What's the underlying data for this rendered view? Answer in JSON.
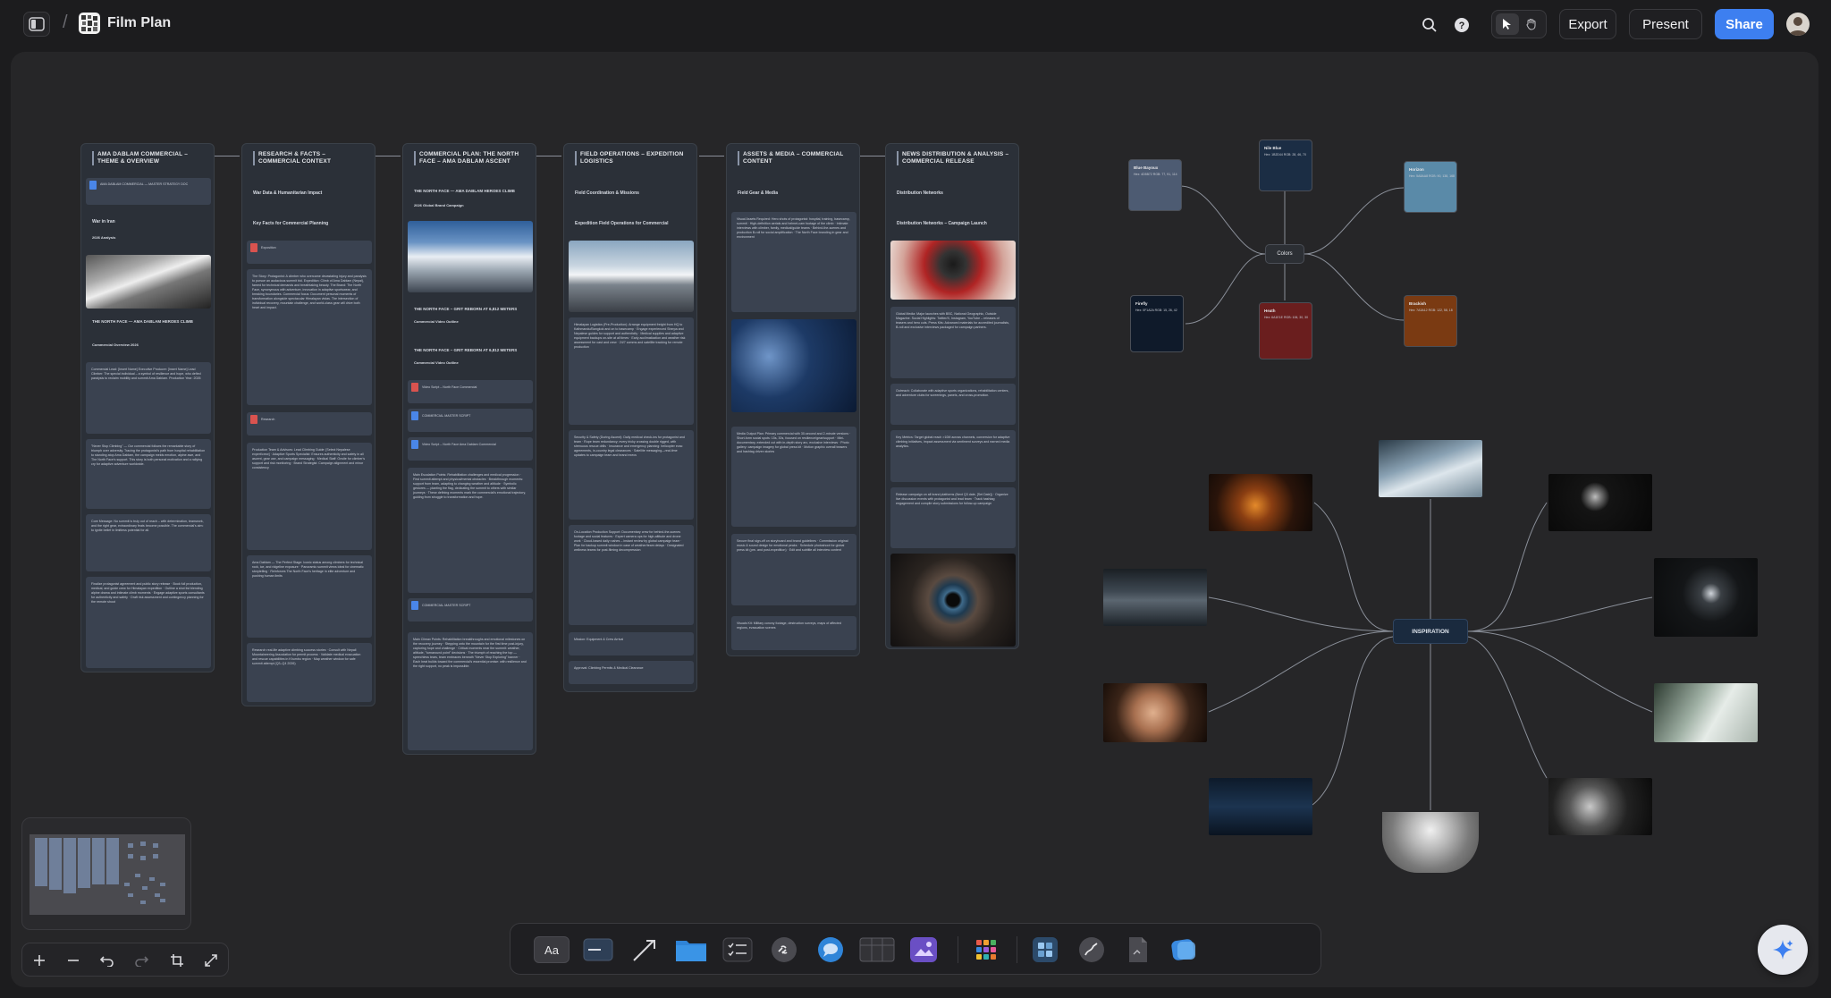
{
  "header": {
    "board_title": "Film Plan",
    "breadcrumb_sep": "/",
    "export_label": "Export",
    "present_label": "Present",
    "share_label": "Share",
    "icons": [
      "sidebar-icon",
      "search-icon",
      "help-icon",
      "pointer-icon",
      "hand-icon",
      "avatar"
    ]
  },
  "columns": [
    {
      "title": "AMA DABLAM COMMERCIAL – THEME & OVERVIEW",
      "lines": [
        "War in Iran",
        "2026 Analysis",
        "THE NORTH FACE — AMA DABLAM HEROES CLIMB",
        "Commercial Overview 2026"
      ],
      "doc": "AMA DABLAM COMMERCIAL — MASTER STRATEGY DOC",
      "card1": "Commercial Lead: [Insert Name] Executive Producer: [Insert Name] Lead Climber: The special individual – a symbol of resilience and hope, who defied paralysis to reclaim mobility and summit Ama Dablam. Production Year: 2026",
      "card2": "\"Never Stop Climbing\" — Our commercial follows the remarkable story of triumph over adversity. Tracing the protagonist's path from hospital rehabilitation to standing atop Ama Dablam, the campaign melds emotion, alpine awe, and The North Face's support. This story is both personal motivation and a rallying cry for adaptive adventure worldwide.",
      "card3": "Core Message: No summit is truly out of reach – with determination, teamwork, and the right gear, extraordinary feats become possible. The commercial's aim: to ignite belief in limitless potential for all.",
      "card4": "Finalize protagonist agreement and public story release · Book full production, medical, and guide crew for Himalayan expedition · Outline a shot list blending alpine drama and intimate climb moments · Engage adaptive sports consultants for authenticity and safety · Draft risk assessment and contingency planning for the remote shoot"
    },
    {
      "title": "RESEARCH & FACTS – COMMERCIAL CONTEXT",
      "lines": [
        "War Data & Humanitarian Impact",
        "Key Facts for Commercial Planning"
      ],
      "doc": "Exposition",
      "card1": "The Story: Protagonist: A climber who overcame devastating injury and paralysis to pursue an audacious summit bid. Expedition: Climb of Ama Dablam (Nepal), famed for technical demands and breathtaking beauty. The Brand: The North Face, synonymous with adventure, innovation in adaptive sportswear, and breaking boundaries. Commercial focus: Document personal moments of transformation alongside spectacular Himalayan vistas. The intersection of individual recovery, mountain challenge, and world-class gear will drive both heart and impact.",
      "doc2": "Research",
      "card2": "Production Team & Advisors: Lead Climbing Guide: [Select Nepalese expert/crew] · Adaptive Sports Specialist: Ensures authenticity and safety in all ascent, gear use, and campaign messaging · Medical Staff: Onsite for climber's support and risk monitoring · Brand Strategist: Campaign alignment and minor consistency",
      "card3": "Ama Dablam — The Perfect Stage: Iconic status among climbers for technical rock, ice, and ridgeline exposure · Panoramic summit views ideal for cinematic storytelling · Reinforces The North Face's heritage in elite adventure and pushing human limits",
      "card4": "Research real-life adaptive climbing success stories · Consult with Nepali Mountaineering Association for permit process · Validate medical evacuation and rescue capabilities in Khumbu region · Map weather window for safe summit attempt (Q3–Q4 2026)"
    },
    {
      "title": "COMMERCIAL PLAN: THE NORTH FACE – AMA DABLAM ASCENT",
      "lines": [
        "THE NORTH FACE — AMA DABLAM HEROES CLIMB",
        "2026 Global Brand Campaign",
        "THE NORTH FACE – GRIT REBORN AT 6,812 METERS",
        "Commercial Video Outline",
        "THE NORTH FACE – GRIT REBORN AT 6,812 METERS",
        "Commercial Video Outline"
      ],
      "docs": [
        "Video Script – North Face Commercial",
        "COMMERCIAL MASTER SCRIPT",
        "Video Script – North Face Ama Dablam Commercial"
      ],
      "card1": "Main Escalation Points: Rehabilitation challenges and medical progression · First summit attempt and physical/mental obstacles · Breakthrough moments: support from team, adapting to changing weather and altitude · Symbolic gestures — planting the flag, dedicating the summit to others with similar journeys · These defining moments mark the commercial's emotional trajectory, guiding from struggle to transformation and hope.",
      "doc4": "COMMERCIAL MASTER SCRIPT",
      "card2": "Main Climax Points: Rehabilitation breakthroughs and emotional milestones on the recovery journey · Stepping onto the mountain for the first time post-injury, capturing hope and challenge · Critical moments near the summit: weather, altitude, \"turnaround point\" decisions · The triumph of reaching the top — speechless tears, team embraces beneath \"Never Stop Exploring\" banner · Each beat builds toward the commercial's essential promise: with resilience and the right support, no peak is impossible."
    },
    {
      "title": "FIELD OPERATIONS – EXPEDITION LOGISTICS",
      "lines": [
        "Field Coordination & Missions",
        "Expedition Field Operations for Commercial"
      ],
      "card1": "Himalayan Logistics (Pre-Production): Arrange equipment freight from HQ to Kathmandu/Bangkok and on to basecamp · Engage experienced Sherpa and Nepalese guides for support and authenticity · Medical supplies and adaptive equipment backups on-site at all times · Early acclimatization and weather risk assessment for cast and crew · 24/7 comms and satellite tracking for remote production",
      "card2": "Security & Safety (During Ascent): Daily medical check-ins for protagonist and team · Rope team redundancy; every tricky crossing double rigged, with strenuous rescue drills · Insurance and emergency planning: helicopter evac agreements, in-country legal clearances · Satellite messaging—real-time updates to campaign team and brand execs",
      "card3": "On-Location Production Support: Documentary crew for behind-the-scenes footage and social features · Expert camera ops for high-altitude and drone work · Cloud-based daily rushes – instant review by global campaign team · Plan for backup summit window in case of weather/team delays · Designated wellness teams for post-filming decompression",
      "card4": "Mission: Equipment & Crew Arrival",
      "card5": "Approval: Climbing Permits & Medical Clearance"
    },
    {
      "title": "ASSETS & MEDIA – COMMERCIAL CONTENT",
      "lines": [
        "Field Gear & Media"
      ],
      "card1": "Visual Assets Required: Hero shots of protagonist: hospital, training, basecamp, summit · High-definition aerials and helmet-cam footage of the climb · Intimate interviews with climber, family, medical/guide teams · Behind-the-scenes and production B-roll for social amplification · The North Face branding in gear and environment",
      "card2": "Media Output Plan: Primary commercial with 30-second and 2-minute versions · Short-form social spots: 15s, 30s, focused on resilience/gear/support · Mini-documentary, extended cut with in-depth story arc, exclusive interviews · Photo gallery: campaign imagery for global press kit · Motion graphic overall teasers and hashtag driven stories",
      "card3": "Secure final sign-off on storyboard and brand guidelines · Commission original music & sound design for emotional peaks · Schedule photoshoot for global press kit (pre- and post-expedition) · Edit and subtitle all interview content",
      "card4": "Visuals Kit: Military convoy footage, destruction surveys, maps of affected regions, evacuation scenes"
    },
    {
      "title": "NEWS DISTRIBUTION & ANALYSIS – COMMERCIAL RELEASE",
      "lines": [
        "Distribution Networks",
        "Distribution Networks – Campaign Launch"
      ],
      "card1": "Global Media: Major launches with BBC, National Geographic, Outside Magazine. Social Highlights: Twitter/X, Instagram, YouTube – releases of teasers and hero cuts. Press Kits: Advanced materials for accredited journalists, B-roll and exclusive interviews packaged for campaign partners.",
      "card2": "Outreach: Collaborate with adaptive sports organizations, rehabilitation centers, and adventure clubs for screenings, panels, and cross-promotion.",
      "card3": "Key Metrics: Target global reach >10M across channels, conversion for adaptive climbing initiatives, impact assessment via sentiment surveys and earned media analytics.",
      "card4": "Release campaign on all brand platforms (Next Q3 date, [Set Date]) · Organize live discussion events with protagonist and lead team · Track hashtag engagement and compile story submissions for follow-up campaign"
    }
  ],
  "colors_map": {
    "hub_label": "Colors",
    "swatches": [
      {
        "name": "Blue Bayoux",
        "hex": "#4D5B72",
        "sub": "Hex: 4D5B72 RGB: 77, 91, 114"
      },
      {
        "name": "Nile Blue",
        "hex": "#1B2D44",
        "sub": "Hex: 1B2D44 RGB: 28, 46, 70"
      },
      {
        "name": "Horizon",
        "hex": "#5A8AA8",
        "sub": "Hex: 5A8AA8 RGB: 90, 138, 168"
      },
      {
        "name": "Firefly",
        "hex": "#0F1A2A",
        "sub": "Hex: 0F1A2A RGB: 15, 26, 42"
      },
      {
        "name": "Heath",
        "hex": "#6A1E1E",
        "sub": "Hex: 6A1E1E RGB: 106, 30, 30"
      },
      {
        "name": "Brackish",
        "hex": "#7A3A12",
        "sub": "Hex: 7A3A12 RGB: 122, 58, 18"
      }
    ]
  },
  "inspiration_map": {
    "hub_label": "INSPIRATION"
  },
  "toolbar": {
    "text_tool_label": "Aa",
    "icons": [
      "text-icon",
      "sticky-note-icon",
      "arrow-icon",
      "folder-icon",
      "checklist-icon",
      "link-icon",
      "comment-icon",
      "table-icon",
      "image-icon",
      "apps-icon",
      "board-icon",
      "pen-icon",
      "file-icon",
      "shape-icon"
    ]
  },
  "zoom": {
    "icons": [
      "zoom-in-icon",
      "zoom-out-icon",
      "undo-icon",
      "redo-icon",
      "fit-icon",
      "fullscreen-icon"
    ]
  }
}
